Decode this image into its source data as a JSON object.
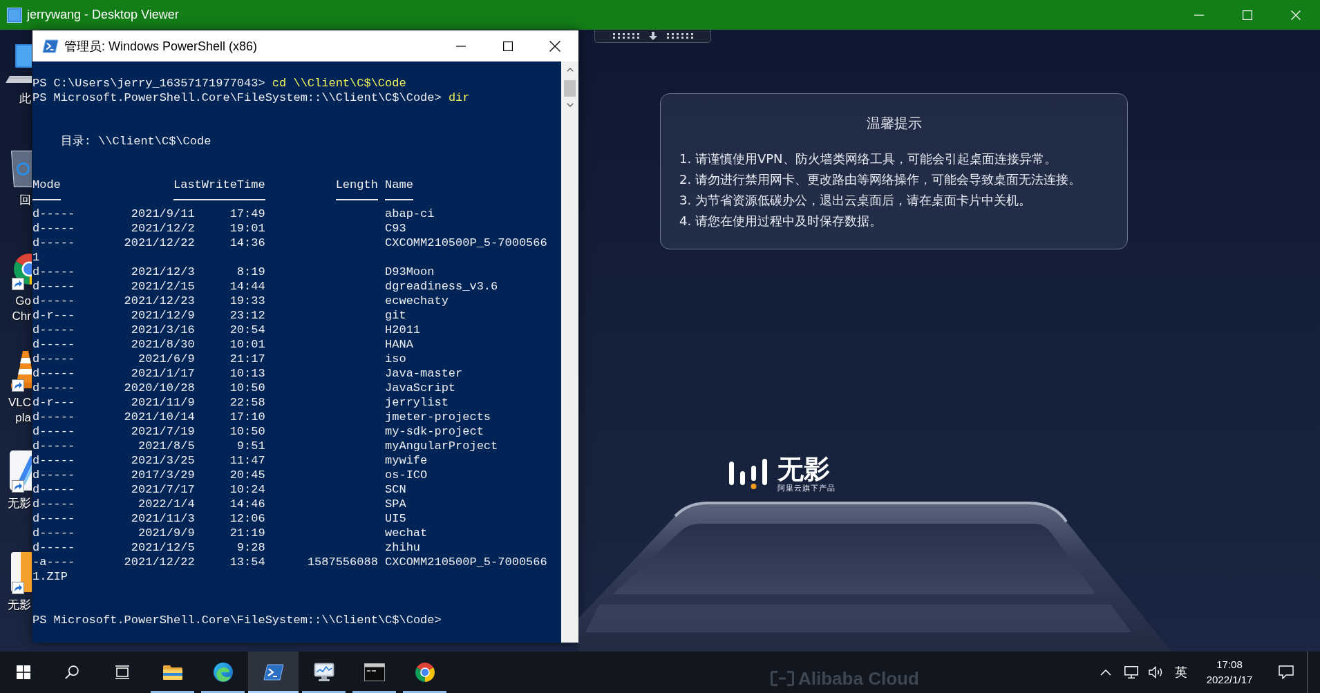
{
  "window": {
    "title": "jerrywang - Desktop Viewer"
  },
  "desktop_icons": [
    {
      "kind": "computer",
      "shortcut": false,
      "label_lines": [
        "此"
      ]
    },
    {
      "kind": "recycle-bin",
      "shortcut": false,
      "label_lines": [
        "回"
      ]
    },
    {
      "kind": "chrome",
      "shortcut": true,
      "label_lines": [
        "Go",
        "Chr"
      ]
    },
    {
      "kind": "vlc",
      "shortcut": true,
      "label_lines": [
        "VLC",
        "pla"
      ]
    },
    {
      "kind": "wuying",
      "shortcut": true,
      "label_lines": [
        "无影"
      ]
    },
    {
      "kind": "orange-app",
      "shortcut": true,
      "label_lines": [
        "无影"
      ]
    }
  ],
  "powershell": {
    "title": "管理员: Windows PowerShell (x86)",
    "commands": [
      {
        "prompt": "PS C:\\Users\\jerry_16357171977043>",
        "command": "cd \\\\Client\\C$\\Code"
      },
      {
        "prompt": "PS Microsoft.PowerShell.Core\\FileSystem::\\\\Client\\C$\\Code>",
        "command": "dir"
      }
    ],
    "directory": "目录: \\\\Client\\C$\\Code",
    "columns": [
      "Mode",
      "LastWriteTime",
      "Length",
      "Name"
    ],
    "entries": [
      {
        "mode": "d-----",
        "date": "2021/9/11",
        "time": "17:49",
        "name": "abap-ci"
      },
      {
        "mode": "d-----",
        "date": "2021/12/2",
        "time": "19:01",
        "name": "C93"
      },
      {
        "mode": "d-----",
        "date": "2021/12/22",
        "time": "14:36",
        "name": "CXCOMM210500P_5-7000566",
        "name_wrap": "1"
      },
      {
        "mode": "d-----",
        "date": "2021/12/3",
        "time": "8:19",
        "name": "D93Moon"
      },
      {
        "mode": "d-----",
        "date": "2021/2/15",
        "time": "14:44",
        "name": "dgreadiness_v3.6"
      },
      {
        "mode": "d-----",
        "date": "2021/12/23",
        "time": "19:33",
        "name": "ecwechaty"
      },
      {
        "mode": "d-r---",
        "date": "2021/12/9",
        "time": "23:12",
        "name": "git"
      },
      {
        "mode": "d-----",
        "date": "2021/3/16",
        "time": "20:54",
        "name": "H2011"
      },
      {
        "mode": "d-----",
        "date": "2021/8/30",
        "time": "10:01",
        "name": "HANA"
      },
      {
        "mode": "d-----",
        "date": "2021/6/9",
        "time": "21:17",
        "name": "iso"
      },
      {
        "mode": "d-----",
        "date": "2021/1/17",
        "time": "10:13",
        "name": "Java-master"
      },
      {
        "mode": "d-----",
        "date": "2020/10/28",
        "time": "10:50",
        "name": "JavaScript"
      },
      {
        "mode": "d-r---",
        "date": "2021/11/9",
        "time": "22:58",
        "name": "jerrylist"
      },
      {
        "mode": "d-----",
        "date": "2021/10/14",
        "time": "17:10",
        "name": "jmeter-projects"
      },
      {
        "mode": "d-----",
        "date": "2021/7/19",
        "time": "10:50",
        "name": "my-sdk-project"
      },
      {
        "mode": "d-----",
        "date": "2021/8/5",
        "time": "9:51",
        "name": "myAngularProject"
      },
      {
        "mode": "d-----",
        "date": "2021/3/25",
        "time": "11:47",
        "name": "mywife"
      },
      {
        "mode": "d-----",
        "date": "2017/3/29",
        "time": "20:45",
        "name": "os-ICO"
      },
      {
        "mode": "d-----",
        "date": "2021/7/17",
        "time": "10:24",
        "name": "SCN"
      },
      {
        "mode": "d-----",
        "date": "2022/1/4",
        "time": "14:46",
        "name": "SPA"
      },
      {
        "mode": "d-----",
        "date": "2021/11/3",
        "time": "12:06",
        "name": "UI5"
      },
      {
        "mode": "d-----",
        "date": "2021/9/9",
        "time": "21:19",
        "name": "wechat"
      },
      {
        "mode": "d-----",
        "date": "2021/12/5",
        "time": "9:28",
        "name": "zhihu"
      },
      {
        "mode": "-a----",
        "date": "2021/12/22",
        "time": "13:54",
        "length": "1587556088",
        "name": "CXCOMM210500P_5-7000566",
        "name_wrap": "1.ZIP"
      }
    ],
    "final_prompt": "PS Microsoft.PowerShell.Core\\FileSystem::\\\\Client\\C$\\Code>"
  },
  "notice": {
    "title": "温馨提示",
    "items": [
      "1. 请谨慎使用VPN、防火墙类网络工具，可能会引起桌面连接异常。",
      "2. 请勿进行禁用网卡、更改路由等网络操作，可能会导致桌面无法连接。",
      "3. 为节省资源低碳办公，退出云桌面后，请在桌面卡片中关机。",
      "4. 请您在使用过程中及时保存数据。"
    ]
  },
  "logo": {
    "name": "无影",
    "tagline": "阿里云旗下产品"
  },
  "taskbar": {
    "apps": [
      {
        "kind": "folder",
        "running": true,
        "selected": false
      },
      {
        "kind": "edge",
        "running": true,
        "selected": false
      },
      {
        "kind": "terminal",
        "running": true,
        "selected": true
      },
      {
        "kind": "monitor",
        "running": true,
        "selected": false
      },
      {
        "kind": "console",
        "running": true,
        "selected": false
      },
      {
        "kind": "chrome",
        "running": true,
        "selected": false
      }
    ],
    "brand_text": "Alibaba Cloud",
    "ime": "英",
    "time": "17:08",
    "date": "2022/1/17"
  }
}
